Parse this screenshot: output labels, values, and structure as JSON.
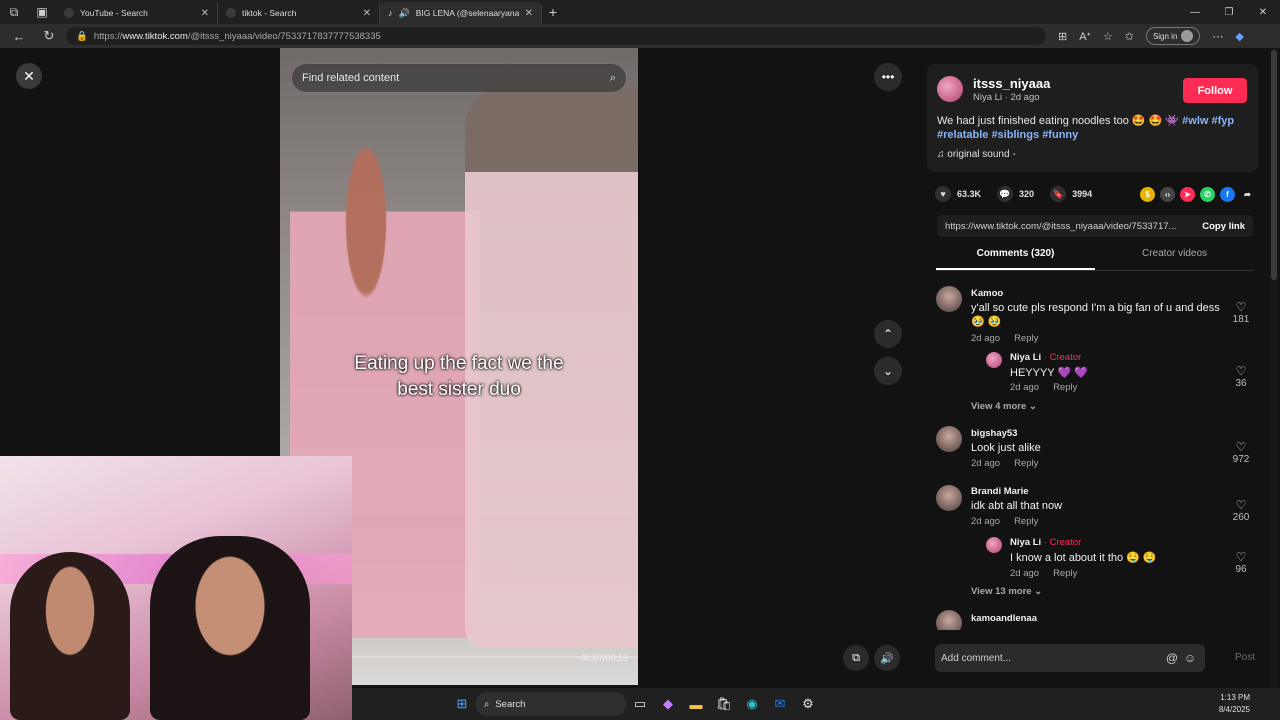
{
  "browser": {
    "tabs": [
      {
        "title": "YouTube - Search",
        "active": false
      },
      {
        "title": "tiktok - Search",
        "active": false
      },
      {
        "title": "BIG LENA (@selenaaryanaa)",
        "active": true
      }
    ],
    "url_prefix": "https://",
    "url_host": "www.tiktok.com",
    "url_path": "/@itsss_niyaaa/video/7533717837777538335",
    "signin_label": "Sign in"
  },
  "video": {
    "search_placeholder": "Find related content",
    "caption_line1": "Eating up the fact we the",
    "caption_line2": "best sister duo",
    "timecode": "00:07/00:15"
  },
  "post": {
    "username": "itsss_niyaaa",
    "display_name_date": "Niya Li · 2d ago",
    "follow_label": "Follow",
    "description": "We had just finished eating noodles too 🤩 🤩 👾",
    "hashtags": [
      "#wlw",
      "#fyp",
      "#relatable",
      "#siblings",
      "#funny"
    ],
    "sound": "original sound -",
    "likes": "63.3K",
    "comments_count": "320",
    "saves": "3994",
    "link": "https://www.tiktok.com/@itsss_niyaaa/video/7533717...",
    "copy_link_label": "Copy link"
  },
  "panel_tabs": {
    "comments": "Comments (320)",
    "creator_videos": "Creator videos"
  },
  "comments": [
    {
      "name": "Kamoo",
      "text": "y'all so cute pls respond I'm a big fan of u and dess 🥹 🥹",
      "date": "2d ago",
      "reply": "Reply",
      "likes": "181"
    },
    {
      "name": "Niya Li",
      "creator": "· Creator",
      "text": "HEYYYY 💜 💜",
      "date": "2d ago",
      "reply": "Reply",
      "likes": "36"
    },
    {
      "view_more": "View 4 more"
    },
    {
      "name": "bigshay53",
      "text": "Look just alike",
      "date": "2d ago",
      "reply": "Reply",
      "likes": "972"
    },
    {
      "name": "Brandi Marie",
      "text": "idk abt all that now",
      "date": "2d ago",
      "reply": "Reply",
      "likes": "260"
    },
    {
      "name": "Niya Li",
      "creator": "· Creator",
      "text": "I know a lot about it tho 🤤 🤤",
      "date": "2d ago",
      "reply": "Reply",
      "likes": "96"
    },
    {
      "view_more": "View 13 more"
    },
    {
      "name": "kamoandlenaa"
    }
  ],
  "composer": {
    "placeholder": "Add comment...",
    "post_label": "Post"
  },
  "taskbar": {
    "search_label": "Search",
    "time": "1:13 PM",
    "date": "8/4/2025"
  },
  "colors": {
    "accent": "#fe2c55",
    "hashtag": "#8ab4f8",
    "background": "#121212"
  }
}
